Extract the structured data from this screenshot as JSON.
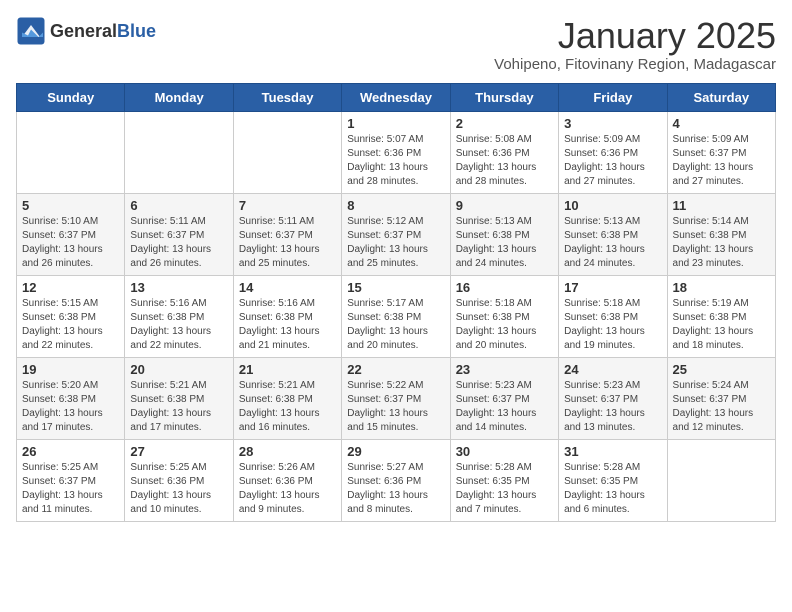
{
  "header": {
    "logo_general": "General",
    "logo_blue": "Blue",
    "month": "January 2025",
    "location": "Vohipeno, Fitovinany Region, Madagascar"
  },
  "weekdays": [
    "Sunday",
    "Monday",
    "Tuesday",
    "Wednesday",
    "Thursday",
    "Friday",
    "Saturday"
  ],
  "weeks": [
    [
      {
        "day": "",
        "info": ""
      },
      {
        "day": "",
        "info": ""
      },
      {
        "day": "",
        "info": ""
      },
      {
        "day": "1",
        "info": "Sunrise: 5:07 AM\nSunset: 6:36 PM\nDaylight: 13 hours\nand 28 minutes."
      },
      {
        "day": "2",
        "info": "Sunrise: 5:08 AM\nSunset: 6:36 PM\nDaylight: 13 hours\nand 28 minutes."
      },
      {
        "day": "3",
        "info": "Sunrise: 5:09 AM\nSunset: 6:36 PM\nDaylight: 13 hours\nand 27 minutes."
      },
      {
        "day": "4",
        "info": "Sunrise: 5:09 AM\nSunset: 6:37 PM\nDaylight: 13 hours\nand 27 minutes."
      }
    ],
    [
      {
        "day": "5",
        "info": "Sunrise: 5:10 AM\nSunset: 6:37 PM\nDaylight: 13 hours\nand 26 minutes."
      },
      {
        "day": "6",
        "info": "Sunrise: 5:11 AM\nSunset: 6:37 PM\nDaylight: 13 hours\nand 26 minutes."
      },
      {
        "day": "7",
        "info": "Sunrise: 5:11 AM\nSunset: 6:37 PM\nDaylight: 13 hours\nand 25 minutes."
      },
      {
        "day": "8",
        "info": "Sunrise: 5:12 AM\nSunset: 6:37 PM\nDaylight: 13 hours\nand 25 minutes."
      },
      {
        "day": "9",
        "info": "Sunrise: 5:13 AM\nSunset: 6:38 PM\nDaylight: 13 hours\nand 24 minutes."
      },
      {
        "day": "10",
        "info": "Sunrise: 5:13 AM\nSunset: 6:38 PM\nDaylight: 13 hours\nand 24 minutes."
      },
      {
        "day": "11",
        "info": "Sunrise: 5:14 AM\nSunset: 6:38 PM\nDaylight: 13 hours\nand 23 minutes."
      }
    ],
    [
      {
        "day": "12",
        "info": "Sunrise: 5:15 AM\nSunset: 6:38 PM\nDaylight: 13 hours\nand 22 minutes."
      },
      {
        "day": "13",
        "info": "Sunrise: 5:16 AM\nSunset: 6:38 PM\nDaylight: 13 hours\nand 22 minutes."
      },
      {
        "day": "14",
        "info": "Sunrise: 5:16 AM\nSunset: 6:38 PM\nDaylight: 13 hours\nand 21 minutes."
      },
      {
        "day": "15",
        "info": "Sunrise: 5:17 AM\nSunset: 6:38 PM\nDaylight: 13 hours\nand 20 minutes."
      },
      {
        "day": "16",
        "info": "Sunrise: 5:18 AM\nSunset: 6:38 PM\nDaylight: 13 hours\nand 20 minutes."
      },
      {
        "day": "17",
        "info": "Sunrise: 5:18 AM\nSunset: 6:38 PM\nDaylight: 13 hours\nand 19 minutes."
      },
      {
        "day": "18",
        "info": "Sunrise: 5:19 AM\nSunset: 6:38 PM\nDaylight: 13 hours\nand 18 minutes."
      }
    ],
    [
      {
        "day": "19",
        "info": "Sunrise: 5:20 AM\nSunset: 6:38 PM\nDaylight: 13 hours\nand 17 minutes."
      },
      {
        "day": "20",
        "info": "Sunrise: 5:21 AM\nSunset: 6:38 PM\nDaylight: 13 hours\nand 17 minutes."
      },
      {
        "day": "21",
        "info": "Sunrise: 5:21 AM\nSunset: 6:38 PM\nDaylight: 13 hours\nand 16 minutes."
      },
      {
        "day": "22",
        "info": "Sunrise: 5:22 AM\nSunset: 6:37 PM\nDaylight: 13 hours\nand 15 minutes."
      },
      {
        "day": "23",
        "info": "Sunrise: 5:23 AM\nSunset: 6:37 PM\nDaylight: 13 hours\nand 14 minutes."
      },
      {
        "day": "24",
        "info": "Sunrise: 5:23 AM\nSunset: 6:37 PM\nDaylight: 13 hours\nand 13 minutes."
      },
      {
        "day": "25",
        "info": "Sunrise: 5:24 AM\nSunset: 6:37 PM\nDaylight: 13 hours\nand 12 minutes."
      }
    ],
    [
      {
        "day": "26",
        "info": "Sunrise: 5:25 AM\nSunset: 6:37 PM\nDaylight: 13 hours\nand 11 minutes."
      },
      {
        "day": "27",
        "info": "Sunrise: 5:25 AM\nSunset: 6:36 PM\nDaylight: 13 hours\nand 10 minutes."
      },
      {
        "day": "28",
        "info": "Sunrise: 5:26 AM\nSunset: 6:36 PM\nDaylight: 13 hours\nand 9 minutes."
      },
      {
        "day": "29",
        "info": "Sunrise: 5:27 AM\nSunset: 6:36 PM\nDaylight: 13 hours\nand 8 minutes."
      },
      {
        "day": "30",
        "info": "Sunrise: 5:28 AM\nSunset: 6:35 PM\nDaylight: 13 hours\nand 7 minutes."
      },
      {
        "day": "31",
        "info": "Sunrise: 5:28 AM\nSunset: 6:35 PM\nDaylight: 13 hours\nand 6 minutes."
      },
      {
        "day": "",
        "info": ""
      }
    ]
  ]
}
